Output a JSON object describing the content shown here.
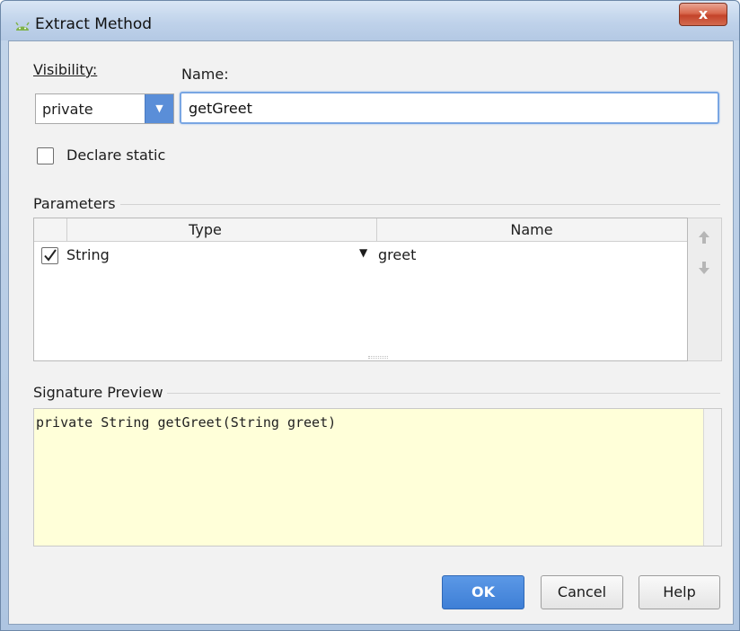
{
  "window": {
    "title": "Extract Method",
    "close_glyph": "x"
  },
  "visibility": {
    "label": "Visibility:",
    "selected": "private"
  },
  "name": {
    "label": "Name:",
    "value": "getGreet"
  },
  "declare_static": {
    "label": "Declare static",
    "checked": false
  },
  "parameters": {
    "label": "Parameters",
    "columns": [
      "Type",
      "Name"
    ],
    "rows": [
      {
        "checked": true,
        "type": "String",
        "name": "greet"
      }
    ]
  },
  "signature_preview": {
    "label": "Signature Preview",
    "text": "private String getGreet(String greet)"
  },
  "buttons": {
    "ok": "OK",
    "cancel": "Cancel",
    "help": "Help"
  },
  "colors": {
    "accent": "#4a86da",
    "preview_bg": "#ffffd9"
  },
  "icons": {
    "app": "android-icon",
    "move_up": "arrow-up-icon",
    "move_down": "arrow-down-icon"
  }
}
